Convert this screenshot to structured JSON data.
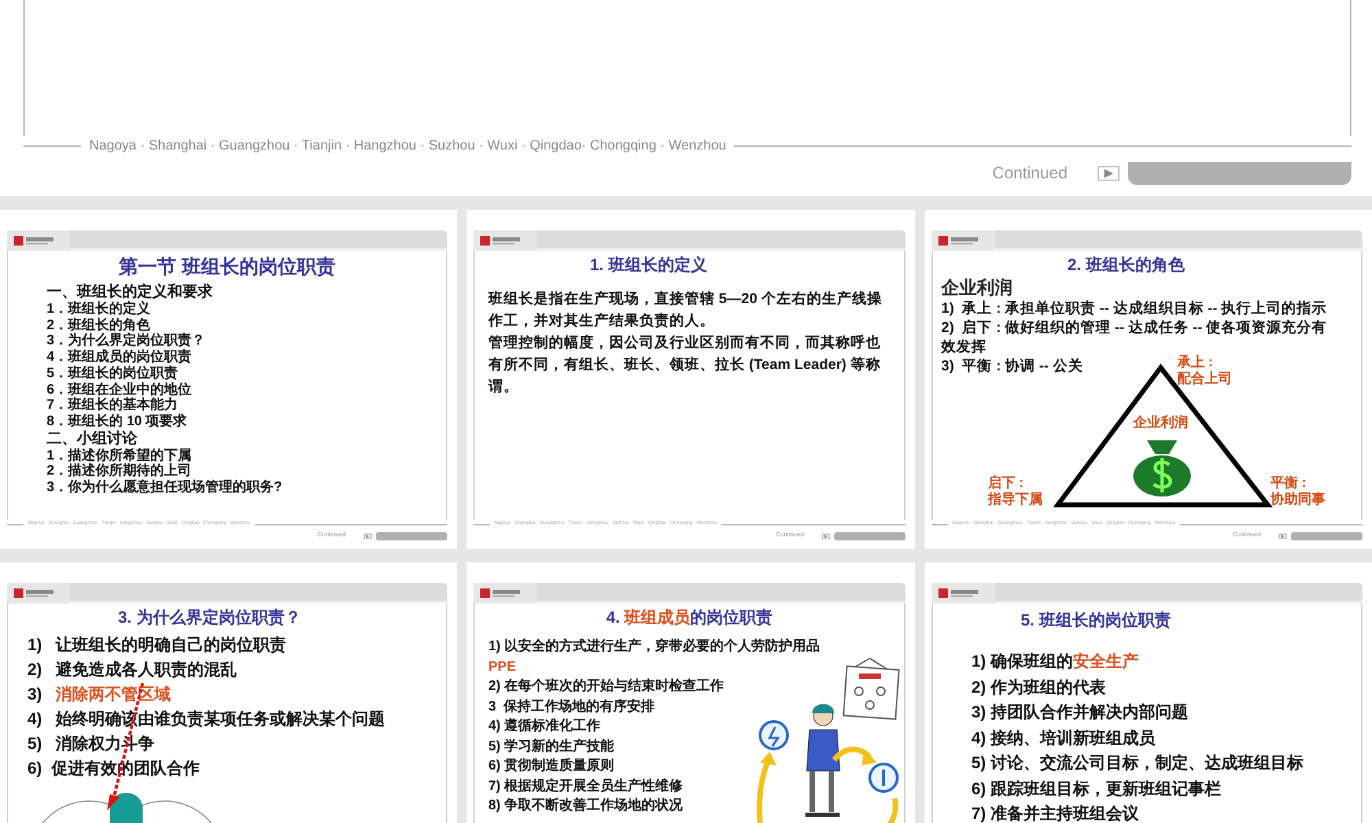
{
  "top_slide": {
    "footer": "Nagoya ·  Shanghai · Guangzhou  · Tianjin · Hangzhou · Suzhou · Wuxi · Qingdao· Chongqing · Wenzhou",
    "continued": "Continued"
  },
  "slides": [
    {
      "kind": "outline",
      "title": [
        {
          "text": "第一节  班组长的岗位职责",
          "accent": false
        }
      ],
      "lines": [
        {
          "text": "一、班组长的定义和要求",
          "heading": true
        },
        {
          "text": "1．班组长的定义",
          "heading": false
        },
        {
          "text": "2．班组长的角色",
          "heading": false
        },
        {
          "text": "3．为什么界定岗位职责？",
          "heading": false
        },
        {
          "text": "4．班组成员的岗位职责",
          "heading": false
        },
        {
          "text": "5．班组长的岗位职责",
          "heading": false
        },
        {
          "text": "6．班组在企业中的地位",
          "heading": false
        },
        {
          "text": "7．班组长的基本能力",
          "heading": false
        },
        {
          "text": "8．班组长的 10 项要求",
          "heading": false
        },
        {
          "text": "二、小组讨论",
          "heading": true
        },
        {
          "text": "1．描述你所希望的下属",
          "heading": false
        },
        {
          "text": "2．描述你所期待的上司",
          "heading": false
        },
        {
          "text": "3．你为什么愿意担任现场管理的职务?",
          "heading": false
        }
      ],
      "footer": "Nagoya ·  Shanghai · Guangzhou  · Tianjin · Hangzhou · Suzhou · Wuxi · Qingdao· Chongqing · Wenzhou",
      "continued": "Continued"
    },
    {
      "kind": "paragraph",
      "title": [
        {
          "text": "1. 班组长的定义",
          "accent": false
        }
      ],
      "paragraphs": [
        "班组长是指在生产现场，直接管辖 5—20 个左右的生产线操作工，并对其生产结果负责的人。",
        "管理控制的幅度，因公司及行业区别而有不同，而其称呼也有所不同，有组长、班长、领班、拉长 (Team Leader) 等称谓。"
      ],
      "footer": "Nagoya ·  Shanghai · Guangzhou  · Tianjin · Hangzhou · Suzhou · Wuxi · Qingdao· Chongqing · Wenzhou",
      "continued": "Continued"
    },
    {
      "kind": "role",
      "title": [
        {
          "text": "2. 班组长的角色",
          "accent": false
        }
      ],
      "heading": "企业利润",
      "lines": [
        {
          "text": "1)  承上 : 承担单位职责 -- 达成组织目标 -- 执行上司的指示"
        },
        {
          "text": "2)  启下 : 做好组织的管理 -- 达成任务 -- 使各项资源充分有效发挥"
        },
        {
          "text": "3)  平衡 : 协调 -- 公关"
        }
      ],
      "diagram": {
        "center_label": "企业利润",
        "labels": [
          {
            "kind": "top",
            "lines": [
              "承上 :",
              "配合上司"
            ]
          },
          {
            "kind": "left",
            "lines": [
              "启下 :",
              "指导下属"
            ]
          },
          {
            "kind": "right",
            "lines": [
              "平衡 :",
              "协助同事"
            ]
          }
        ]
      },
      "footer": "Nagoya ·  Shanghai · Guangzhou  · Tianjin · Hangzhou · Suzhou · Wuxi · Qingdao· Chongqing · Wenzhou",
      "continued": "Continued"
    },
    {
      "kind": "list-venn",
      "title": [
        {
          "text": "3. 为什么界定岗位职责？",
          "accent": false
        }
      ],
      "lines": [
        {
          "text": "1)   让班组长的明确自己的岗位职责"
        },
        {
          "text": "2)   避免造成各人职责的混乱"
        },
        {
          "parts": [
            {
              "text": "3)   ",
              "accent": false
            },
            {
              "text": "消除两不管区域",
              "accent": true
            }
          ]
        },
        {
          "text": "4)   始终明确该由谁负责某项任务或解决某个问题"
        },
        {
          "text": "5)   消除权力斗争"
        },
        {
          "text": "6)  促进有效的团队合作"
        }
      ]
    },
    {
      "kind": "list-illustration",
      "title": [
        {
          "text": "4. ",
          "accent": false
        },
        {
          "text": "班组成员",
          "accent": true
        },
        {
          "text": "的岗位职责",
          "accent": false
        }
      ],
      "lines": [
        {
          "parts": [
            {
              "text": "1) 以安全的方式进行生产，穿带必要的个人劳防护用品",
              "accent": false,
              "own_line": true
            },
            {
              "text": "PPE",
              "accent": true,
              "own_line": true
            }
          ]
        },
        {
          "text": "2) 在每个班次的开始与结束时检查工作"
        },
        {
          "text": "3  保持工作场地的有序安排"
        },
        {
          "text": "4) 遵循标准化工作"
        },
        {
          "text": "5) 学习新的生产技能"
        },
        {
          "text": "6) 贯彻制造质量原则"
        },
        {
          "text": "7) 根据规定开展全员生产性维修"
        },
        {
          "text": "8) 争取不断改善工作场地的状况"
        }
      ]
    },
    {
      "kind": "list",
      "title": [
        {
          "text": "5. 班组长的岗位职责",
          "accent": false
        }
      ],
      "lines": [
        {
          "parts": [
            {
              "text": "1) 确保班组的",
              "accent": false
            },
            {
              "text": "安全生产",
              "accent": true
            }
          ]
        },
        {
          "text": "2) 作为班组的代表"
        },
        {
          "text": "3) 持团队合作并解决内部问题"
        },
        {
          "text": "4) 接纳、培训新班组成员"
        },
        {
          "text": "5) 讨论、交流公司目标，制定、达成班组目标"
        },
        {
          "text": "6) 跟踪班组目标，更新班组记事栏"
        },
        {
          "text": "7) 准备并主持班组会议"
        }
      ]
    }
  ]
}
